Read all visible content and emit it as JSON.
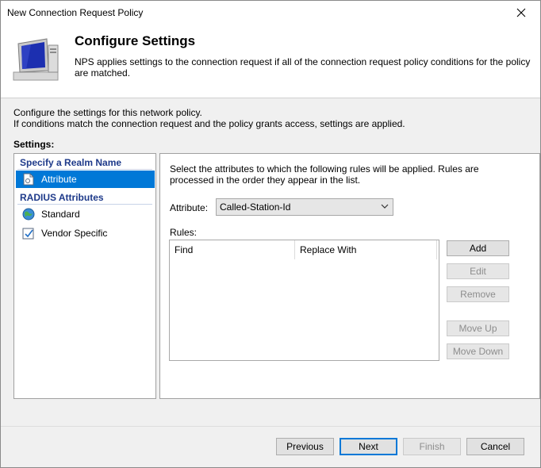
{
  "window": {
    "title": "New Connection Request Policy"
  },
  "header": {
    "title": "Configure Settings",
    "description": "NPS applies settings to the connection request if all of the connection request policy conditions  for the policy are matched."
  },
  "intro": {
    "line1": "Configure the settings for this network policy.",
    "line2": "If conditions match the connection request and the policy grants access, settings are applied."
  },
  "settings_label": "Settings:",
  "nav": {
    "group1": "Specify a Realm Name",
    "group1_items": [
      {
        "label": "Attribute",
        "icon": "document-icon",
        "selected": true
      }
    ],
    "group2": "RADIUS Attributes",
    "group2_items": [
      {
        "label": "Standard",
        "icon": "globe-icon"
      },
      {
        "label": "Vendor Specific",
        "icon": "checkbox-icon"
      }
    ]
  },
  "content": {
    "description": "Select the attributes to which the following rules will be applied. Rules are processed in the order they appear in the list.",
    "attribute_label": "Attribute:",
    "attribute_value": "Called-Station-Id",
    "rules_label": "Rules:",
    "columns": [
      "Find",
      "Replace With"
    ],
    "rows": [],
    "buttons": {
      "add": "Add",
      "edit": "Edit",
      "remove": "Remove",
      "move_up": "Move Up",
      "move_down": "Move Down"
    }
  },
  "footer": {
    "previous": "Previous",
    "next": "Next",
    "finish": "Finish",
    "cancel": "Cancel"
  },
  "colors": {
    "selection": "#0078d7",
    "nav_header": "#1e3a8a"
  }
}
